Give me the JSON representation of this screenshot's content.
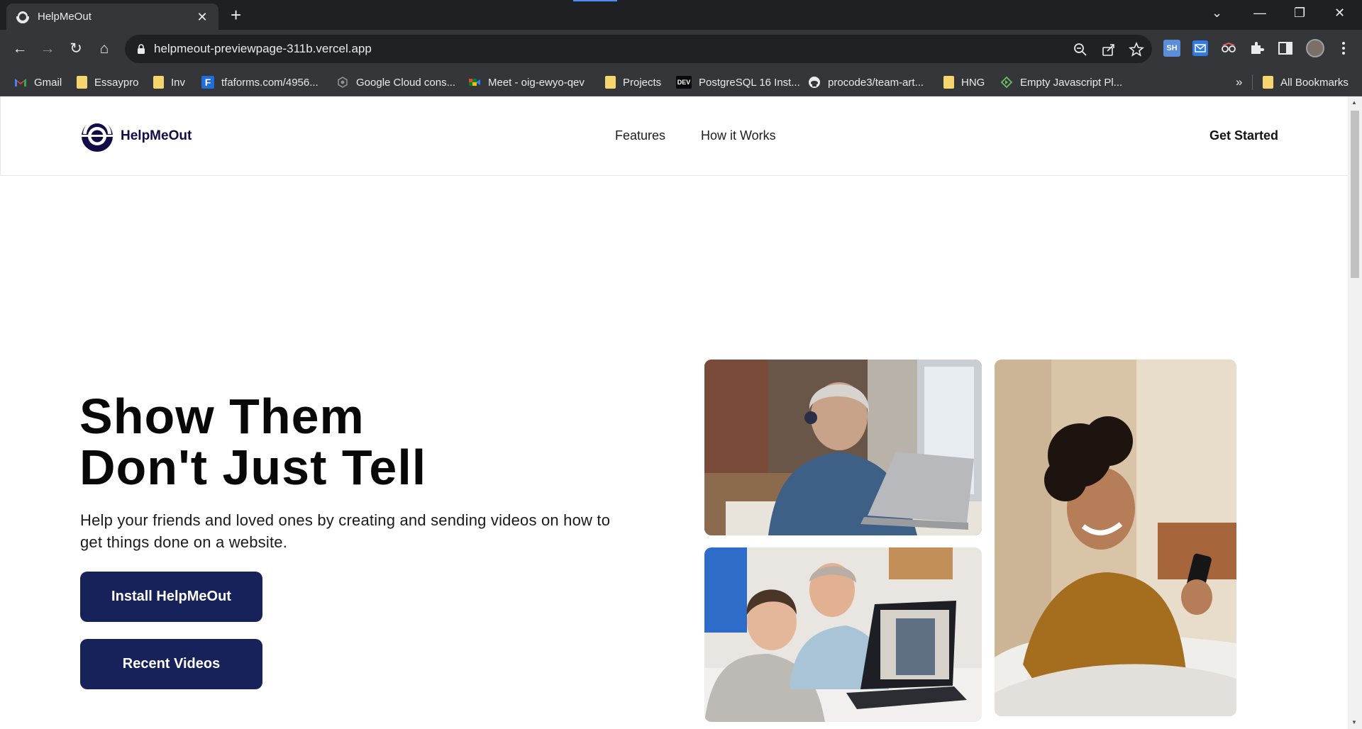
{
  "browser": {
    "tab_title": "HelpMeOut",
    "new_tab_symbol": "+",
    "close_symbol": "✕",
    "url": "helpmeout-previewpage-311b.vercel.app",
    "window_controls": {
      "dropdown": "⌄",
      "minimize": "—",
      "restore": "❐",
      "close": "✕"
    },
    "nav": {
      "back": "←",
      "forward": "→",
      "reload": "↻",
      "home": "⌂"
    },
    "bookmarks": [
      {
        "label": "Gmail",
        "icon": "gmail-icon"
      },
      {
        "label": "Essaypro",
        "icon": "folder-icon"
      },
      {
        "label": "Inv",
        "icon": "folder-icon"
      },
      {
        "label": "tfaforms.com/4956...",
        "icon": "formassembly-icon"
      },
      {
        "label": "Google Cloud cons...",
        "icon": "google-cloud-icon"
      },
      {
        "label": "Meet - oig-ewyo-qev",
        "icon": "google-meet-icon"
      },
      {
        "label": "Projects",
        "icon": "folder-icon"
      },
      {
        "label": "PostgreSQL 16 Inst...",
        "icon": "dev-icon"
      },
      {
        "label": "procode3/team-art...",
        "icon": "github-icon"
      },
      {
        "label": "HNG",
        "icon": "folder-icon"
      },
      {
        "label": "Empty Javascript Pl...",
        "icon": "playground-icon"
      }
    ],
    "bookmarks_overflow": "»",
    "all_bookmarks": "All Bookmarks",
    "extension_sh": "SH"
  },
  "site": {
    "brand": "HelpMeOut",
    "nav": [
      {
        "label": "Features"
      },
      {
        "label": "How it Works"
      }
    ],
    "cta": "Get Started",
    "hero": {
      "title_line1": "Show Them",
      "title_line2": "Don't Just Tell",
      "subtitle": "Help your friends and loved ones by creating and sending videos on how to get things done on a website.",
      "primary_button": "Install HelpMeOut",
      "secondary_button": "Recent Videos"
    },
    "brand_color": "#17225a",
    "logo_color": "#120b48"
  }
}
